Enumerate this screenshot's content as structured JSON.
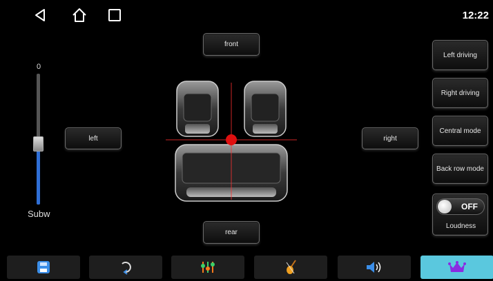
{
  "status": {
    "time": "12:22"
  },
  "nav": {
    "icons": [
      "back-icon",
      "home-icon",
      "recents-icon"
    ]
  },
  "balance": {
    "front_label": "front",
    "rear_label": "rear",
    "left_label": "left",
    "right_label": "right"
  },
  "subwoofer": {
    "label": "Subw",
    "value": "0",
    "level_fraction": 0.5
  },
  "modes": [
    {
      "label": "Left driving"
    },
    {
      "label": "Right driving"
    },
    {
      "label": "Central mode"
    },
    {
      "label": "Back row mode"
    }
  ],
  "loudness": {
    "label": "Loudness",
    "state": "OFF"
  },
  "bottom_tabs": [
    {
      "icon": "save-icon",
      "active": false
    },
    {
      "icon": "reset-icon",
      "active": false
    },
    {
      "icon": "equalizer-icon",
      "active": false
    },
    {
      "icon": "instrument-icon",
      "active": false
    },
    {
      "icon": "speaker-icon",
      "active": false
    },
    {
      "icon": "crown-icon",
      "active": true
    }
  ],
  "colors": {
    "accent": "#5ac8de",
    "slider": "#2f6fd6",
    "balance_dot": "#e01010"
  }
}
